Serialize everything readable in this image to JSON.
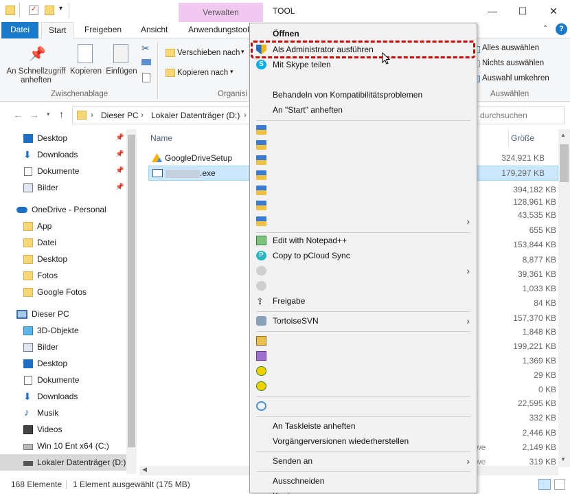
{
  "window": {
    "verwalten_tab": "Verwalten",
    "tool_label": "TOOL",
    "controls": [
      "—",
      "☐",
      "✕"
    ]
  },
  "ribbon_tabs": [
    "Datei",
    "Start",
    "Freigeben",
    "Ansicht",
    "Anwendungstool"
  ],
  "ribbon": {
    "pin_label": "An Schnellzugriff anheften",
    "copy_label": "Kopieren",
    "paste_label": "Einfügen",
    "group_clipboard": "Zwischenablage",
    "move_to": "Verschieben nach",
    "copy_to": "Kopieren nach",
    "group_organize": "Organisi",
    "select_all": "Alles auswählen",
    "select_none": "Nichts auswählen",
    "invert_selection": "Auswahl umkehren",
    "group_select": "Auswählen"
  },
  "address": {
    "crumbs": [
      "Dieser PC",
      "Lokaler Datenträger (D:)"
    ],
    "search_placeholder": "durchsuchen"
  },
  "nav": {
    "quick_access": [
      {
        "label": "Desktop",
        "icon": "desktop-icon"
      },
      {
        "label": "Downloads",
        "icon": "download-icon"
      },
      {
        "label": "Dokumente",
        "icon": "document-icon"
      },
      {
        "label": "Bilder",
        "icon": "pictures-icon"
      }
    ],
    "onedrive_label": "OneDrive - Personal",
    "onedrive_items": [
      "App",
      "Datei",
      "Desktop",
      "Fotos",
      "Google Fotos"
    ],
    "pc_label": "Dieser PC",
    "pc_items": [
      {
        "label": "3D-Objekte",
        "icon": "cube-icon"
      },
      {
        "label": "Bilder",
        "icon": "pictures-icon"
      },
      {
        "label": "Desktop",
        "icon": "desktop-icon"
      },
      {
        "label": "Dokumente",
        "icon": "document-icon"
      },
      {
        "label": "Downloads",
        "icon": "download-icon"
      },
      {
        "label": "Musik",
        "icon": "music-icon"
      },
      {
        "label": "Videos",
        "icon": "video-icon"
      },
      {
        "label": "Win 10 Ent x64 (C:)",
        "icon": "drive-c-icon"
      },
      {
        "label": "Lokaler Datenträger (D:)",
        "icon": "drive-d-icon"
      }
    ]
  },
  "filelist": {
    "col_name": "Name",
    "col_size": "Größe",
    "files": [
      {
        "name": "GoogleDriveSetup",
        "size": "324,921 KB"
      },
      {
        "name": ".exe",
        "size": "179,297 KB",
        "selected": true
      }
    ],
    "sizes": [
      "394,182 KB",
      "128,961 KB",
      "43,535 KB",
      "655 KB",
      "153,844 KB",
      "8,877 KB",
      "39,361 KB",
      "1,033 KB",
      "84 KB",
      "157,370 KB",
      "1,848 KB",
      "199,221 KB",
      "1,369 KB",
      "29 KB",
      "0 KB",
      "22,595 KB",
      "332 KB",
      "2,446 KB",
      "2,149 KB",
      "319 KB"
    ],
    "partial_type_texts": [
      "t",
      "we",
      "we"
    ]
  },
  "context_menu": {
    "open": "Öffnen",
    "run_as_admin": "Als Administrator ausführen",
    "skype": "Mit Skype teilen",
    "compat": "Behandeln von Kompatibilitätsproblemen",
    "pin_start": "An \"Start\" anheften",
    "notepad": "Edit with Notepad++",
    "pcloud": "Copy to pCloud Sync",
    "share": "Freigabe",
    "svn": "TortoiseSVN",
    "taskbar": "An Taskleiste anheften",
    "restore": "Vorgängerversionen wiederherstellen",
    "send_to": "Senden an",
    "cut": "Ausschneiden",
    "copy_partial": "Kopieren"
  },
  "status": {
    "count": "168 Elemente",
    "selection": "1 Element ausgewählt (175 MB)"
  },
  "colors": {
    "accent": "#1979ca",
    "selection": "#cce8ff",
    "highlight_border": "#d00000",
    "verwalten": "#f0c8f0"
  }
}
